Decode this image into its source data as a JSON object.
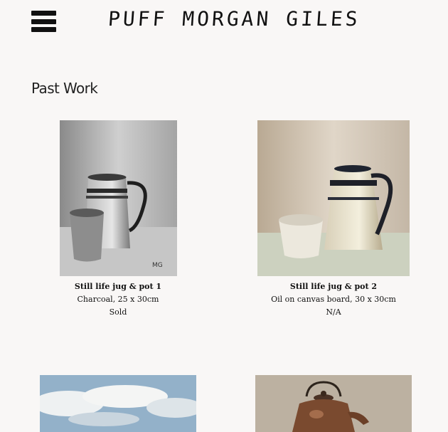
{
  "header": {
    "menu_icon": "hamburger-menu-icon",
    "site_title": "PUFF MORGAN GILES"
  },
  "main": {
    "heading": "Past Work",
    "artworks": [
      {
        "title": "Still life jug & pot 1",
        "medium": "Charcoal, 25 x 30cm",
        "status": "Sold",
        "image": "charcoal still life of a striped jug and a small pot"
      },
      {
        "title": "Still life jug & pot 2",
        "medium": "Oil on canvas board, 30 x 30cm",
        "status": "N/A",
        "image": "oil painting of a cream jug with dark stripes and a white cup"
      },
      {
        "image": "painting of a cloudy sky over a landscape"
      },
      {
        "image": "painting of a copper teapot"
      }
    ]
  }
}
